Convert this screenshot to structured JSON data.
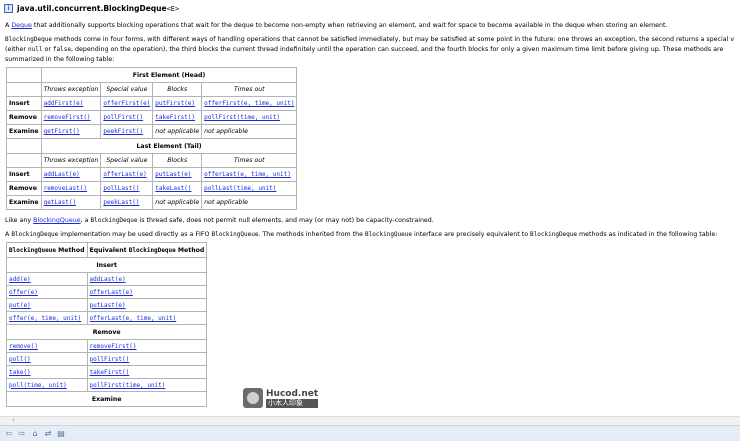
{
  "title": {
    "package": "java.util.concurrent.",
    "class_name": "BlockingDeque",
    "type_param": "<E>"
  },
  "intro": {
    "link": "Deque",
    "rest": " that additionally supports blocking operations that wait for the deque to become non-empty when retrieving an element, and wait for space to become available in the deque when storing an element."
  },
  "para2": {
    "code1": "BlockingDeque",
    "text1": " methods come in four forms, with different ways of handling operations that cannot be satisfied immediately, but may be satisfied at some point in the future: one throws an exception, the second returns a special v",
    "text2": "(either ",
    "code2": "null",
    "text3": " or ",
    "code3": "false",
    "text4": ", depending on the operation), the third blocks the current thread indefinitely until the operation can succeed, and the fourth blocks for only a given maximum time limit before giving up. These methods are",
    "text5": "summarized in the following table:"
  },
  "ops_table": {
    "first_title": "First Element (Head)",
    "last_title": "Last Element (Tail)",
    "headers": [
      "Throws exception",
      "Special value",
      "Blocks",
      "Times out"
    ],
    "first_rows": [
      {
        "label": "Insert",
        "cells": [
          "addFirst(e)",
          "offerFirst(e)",
          "putFirst(e)",
          "offerFirst(e, time, unit)"
        ],
        "links": [
          true,
          true,
          true,
          true
        ]
      },
      {
        "label": "Remove",
        "cells": [
          "removeFirst()",
          "pollFirst()",
          "takeFirst()",
          "pollFirst(time, unit)"
        ],
        "links": [
          true,
          true,
          true,
          true
        ]
      },
      {
        "label": "Examine",
        "cells": [
          "getFirst()",
          "peekFirst()",
          "not applicable",
          "not applicable"
        ],
        "links": [
          true,
          true,
          false,
          false
        ]
      }
    ],
    "last_rows": [
      {
        "label": "Insert",
        "cells": [
          "addLast(e)",
          "offerLast(e)",
          "putLast(e)",
          "offerLast(e, time, unit)"
        ],
        "links": [
          true,
          true,
          true,
          true
        ]
      },
      {
        "label": "Remove",
        "cells": [
          "removeLast()",
          "pollLast()",
          "takeLast()",
          "pollLast(time, unit)"
        ],
        "links": [
          true,
          true,
          true,
          true
        ]
      },
      {
        "label": "Examine",
        "cells": [
          "getLast()",
          "peekLast()",
          "not applicable",
          "not applicable"
        ],
        "links": [
          true,
          true,
          false,
          false
        ]
      }
    ]
  },
  "para3": {
    "t1": "Like any ",
    "link": "BlockingQueue",
    "t2": ", a ",
    "code": "BlockingDeque",
    "t3": " is thread safe, does not permit null elements, and may (or may not) be capacity-constrained."
  },
  "para4": {
    "t1": "A ",
    "code1": "BlockingDeque",
    "t2": " implementation may be used directly as a FIFO ",
    "code2": "BlockingQueue",
    "t3": ". The methods inherited from the ",
    "code3": "BlockingQueue",
    "t4": " interface are precisely equivalent to ",
    "code4": "BlockingDeque",
    "t5": " methods as indicated in the following table:"
  },
  "eq_table": {
    "col1_code": "BlockingQueue",
    "col1_text": " Method",
    "col2_text_pre": "Equivalent ",
    "col2_code": "BlockingDeque",
    "col2_text": " Method",
    "sections": [
      {
        "title": "Insert",
        "rows": [
          [
            "add(e)",
            "addLast(e)"
          ],
          [
            "offer(e)",
            "offerLast(e)"
          ],
          [
            "put(e)",
            "putLast(e)"
          ],
          [
            "offer(e, time, unit)",
            "offerLast(e, time, unit)"
          ]
        ]
      },
      {
        "title": "Remove",
        "rows": [
          [
            "remove()",
            "removeFirst()"
          ],
          [
            "poll()",
            "pollFirst()"
          ],
          [
            "take()",
            "takeFirst()"
          ],
          [
            "poll(time, unit)",
            "pollFirst(time, unit)"
          ]
        ]
      },
      {
        "title": "Examine",
        "rows": []
      }
    ]
  },
  "watermark": {
    "main": "Hucod.net",
    "sub": "小木人印象"
  },
  "icons": [
    "doc-icon",
    "back-icon",
    "forward-icon",
    "home-icon",
    "sync-icon",
    "print-icon",
    "scroll-left-icon"
  ]
}
